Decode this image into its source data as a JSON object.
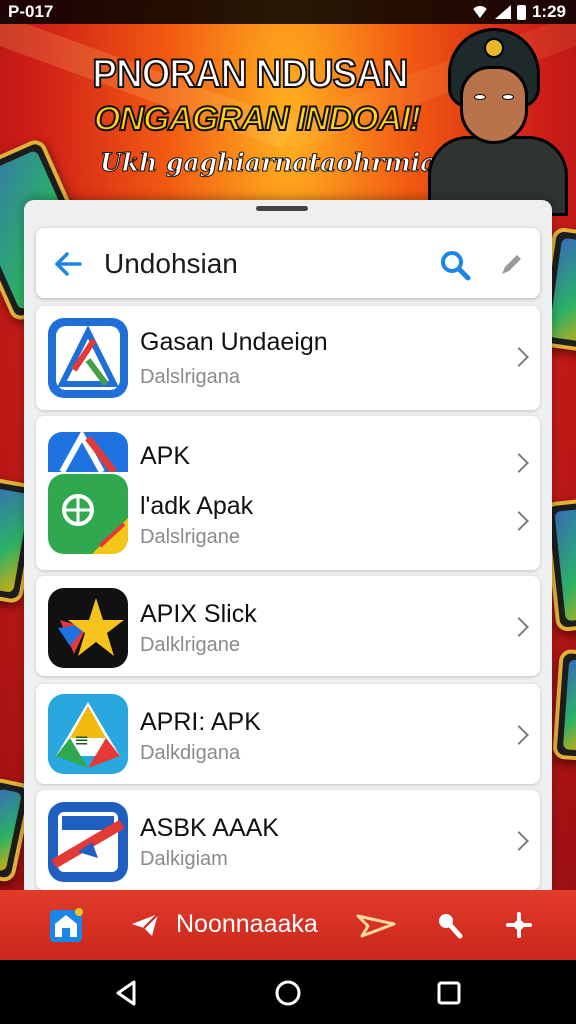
{
  "status_bar": {
    "left_text": "P-017",
    "time": "1:29"
  },
  "banner": {
    "title": "PNORAN NDUSAN",
    "subtitle": "ONGAGRAN INDOAI!",
    "tagline": "Ukh gaghiarnataohrmian"
  },
  "search": {
    "query": "Undohsian"
  },
  "apps": [
    {
      "name": "Gasan Undaeign",
      "sub": "Dalslrigana",
      "icon": "arrow-a-app-icon"
    },
    {
      "name": "APK",
      "sub": "",
      "icon": "triangle-app-icon"
    },
    {
      "name": "l'adk Apak",
      "sub": "Dalslrigane",
      "icon": "green-shield-app-icon"
    },
    {
      "name": "APIX Slick",
      "sub": "Dalklrigane",
      "icon": "star-app-icon"
    },
    {
      "name": "APRI: APK",
      "sub": "Dalkdigana",
      "icon": "drive-app-icon"
    },
    {
      "name": "ASBK AAAK",
      "sub": "Dalkigiam",
      "icon": "stamp-app-icon"
    }
  ],
  "bottom_nav": {
    "label": "Noonnaaaka"
  },
  "colors": {
    "accent": "#1c86e8",
    "nav_bar": "#d6301f",
    "banner_yellow": "#ffd21a"
  }
}
